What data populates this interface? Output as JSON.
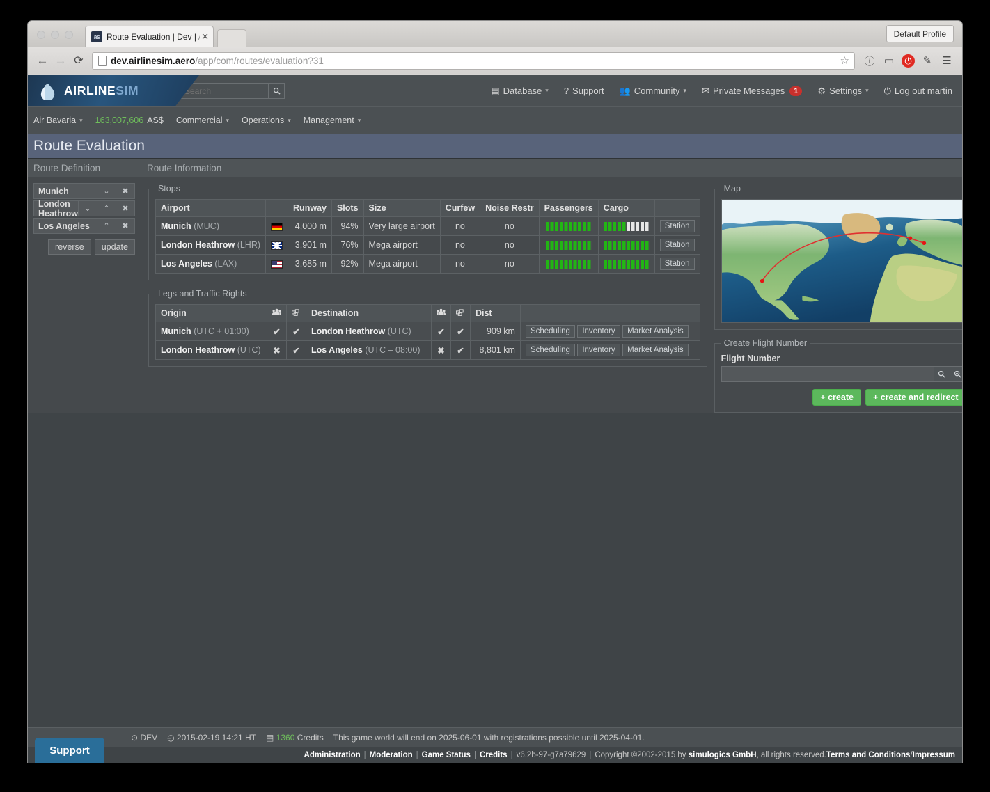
{
  "browser": {
    "tab_title": "Route Evaluation | Dev | ",
    "tab_title_dim": "Air",
    "favicon_text": "as",
    "close_glyph": "✕",
    "profile_label": "Default Profile",
    "url_bold": "dev.airlinesim.aero",
    "url_rest": "/app/com/routes/evaluation?31",
    "back_glyph": "←",
    "forward_glyph": "→",
    "reload_glyph": "⟳",
    "star_glyph": "☆",
    "info_glyph": "ⓘ",
    "cast_glyph": "▭",
    "power_glyph": "⏻",
    "pin_glyph": "✎",
    "menu_glyph": "☰"
  },
  "topnav": {
    "logo_main": "AIRLINE",
    "logo_accent": "SIM",
    "search_placeholder": "Search",
    "search_icon": "🔍",
    "links": [
      {
        "label": "Database",
        "icon": "▤",
        "caret": "▾"
      },
      {
        "label": "Support",
        "icon": "?",
        "caret": ""
      },
      {
        "label": "Community",
        "icon": "👥",
        "caret": "▾"
      },
      {
        "label": "Private Messages",
        "icon": "✉",
        "caret": "",
        "badge": "1"
      },
      {
        "label": "Settings",
        "icon": "⚙",
        "caret": "▾"
      },
      {
        "label": "Log out martin",
        "icon": "⏻",
        "caret": ""
      }
    ]
  },
  "companynav": {
    "airline": "Air Bavaria",
    "caret": "▾",
    "balance": "163,007,606",
    "currency": "AS$",
    "menus": [
      "Commercial",
      "Operations",
      "Management"
    ]
  },
  "page_title": "Route Evaluation",
  "route_definition": {
    "header": "Route Definition",
    "stops": [
      {
        "name": "Munich",
        "down": "⌄",
        "up": "",
        "remove": "✖"
      },
      {
        "name": "London Heathrow",
        "down": "⌄",
        "up": "⌃",
        "remove": "✖"
      },
      {
        "name": "Los Angeles",
        "down": "",
        "up": "⌃",
        "remove": "✖"
      }
    ],
    "reverse_label": "reverse",
    "update_label": "update"
  },
  "route_information": {
    "header": "Route Information",
    "stops_legend": "Stops",
    "stops_columns": [
      "Airport",
      "",
      "Runway",
      "Slots",
      "Size",
      "Curfew",
      "Noise Restr",
      "Passengers",
      "Cargo",
      ""
    ],
    "stops_rows": [
      {
        "airport": "Munich",
        "code": "(MUC)",
        "flag": "de",
        "runway": "4,000 m",
        "slots": "94%",
        "size": "Very large airport",
        "curfew": "no",
        "noise": "no",
        "passengers_pct": 100,
        "cargo_pct": 50,
        "station_label": "Station"
      },
      {
        "airport": "London Heathrow",
        "code": "(LHR)",
        "flag": "gb",
        "runway": "3,901 m",
        "slots": "76%",
        "size": "Mega airport",
        "curfew": "no",
        "noise": "no",
        "passengers_pct": 100,
        "cargo_pct": 100,
        "station_label": "Station"
      },
      {
        "airport": "Los Angeles",
        "code": "(LAX)",
        "flag": "us",
        "runway": "3,685 m",
        "slots": "92%",
        "size": "Mega airport",
        "curfew": "no",
        "noise": "no",
        "passengers_pct": 100,
        "cargo_pct": 100,
        "station_label": "Station"
      }
    ],
    "legs_legend": "Legs and Traffic Rights",
    "legs_columns": [
      "Origin",
      "👥",
      "📦",
      "Destination",
      "👥",
      "📦",
      "Dist",
      ""
    ],
    "legs_rows": [
      {
        "origin": "Munich",
        "origin_tz": "(UTC + 01:00)",
        "origin_pax": "✔",
        "origin_pax_ok": true,
        "origin_cargo": "✔",
        "origin_cargo_ok": true,
        "destination": "London Heathrow",
        "destination_tz": "(UTC)",
        "dest_pax": "✔",
        "dest_pax_ok": true,
        "dest_cargo": "✔",
        "dest_cargo_ok": true,
        "dist": "909 km",
        "buttons": [
          "Scheduling",
          "Inventory",
          "Market Analysis"
        ]
      },
      {
        "origin": "London Heathrow",
        "origin_tz": "(UTC)",
        "origin_pax": "✖",
        "origin_pax_ok": false,
        "origin_cargo": "✔",
        "origin_cargo_ok": true,
        "destination": "Los Angeles",
        "destination_tz": "(UTC – 08:00)",
        "dest_pax": "✖",
        "dest_pax_ok": false,
        "dest_cargo": "✔",
        "dest_cargo_ok": true,
        "dist": "8,801 km",
        "buttons": [
          "Scheduling",
          "Inventory",
          "Market Analysis"
        ]
      }
    ]
  },
  "map": {
    "legend": "Map",
    "route_points": [
      "Los Angeles",
      "London Heathrow",
      "Munich"
    ]
  },
  "create_flight_number": {
    "legend": "Create Flight Number",
    "field_label": "Flight Number",
    "field_value": "",
    "field_placeholder": "",
    "search_icon": "🔍",
    "zoom_icon": "⊕",
    "create_label": "+ create",
    "create_redirect_label": "+ create and redirect"
  },
  "footer": {
    "support_label": "Support",
    "env_icon": "⊙",
    "env": "DEV",
    "clock_icon": "◴",
    "datetime": "2015-02-19 14:21 HT",
    "credits_icon": "▤",
    "credits_value": "1360",
    "credits_label": "Credits",
    "notice": "This game world will end on 2025-06-01 with registrations possible until 2025-04-01.",
    "links": [
      "Administration",
      "Moderation",
      "Game Status",
      "Credits"
    ],
    "version": "v6.2b-97-g7a79629",
    "copyright_pre": "Copyright ©2002-2015 by ",
    "copyright_company": "simulogics GmbH",
    "copyright_post": ", all rights reserved. ",
    "terms": "Terms and Conditions",
    "slash": " / ",
    "impressum": "Impressum"
  },
  "colors": {
    "accent_green": "#5cb85c",
    "brand_blue": "#28557d",
    "title_bar": "#58637a",
    "danger_red": "#c9302c"
  }
}
